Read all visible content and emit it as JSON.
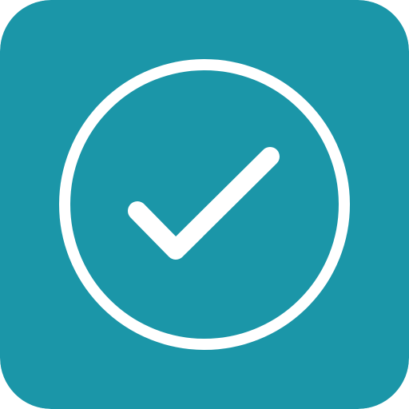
{
  "icon": {
    "name": "check-circle-icon",
    "background_color": "#1B96A8",
    "foreground_color": "#FFFFFF"
  }
}
